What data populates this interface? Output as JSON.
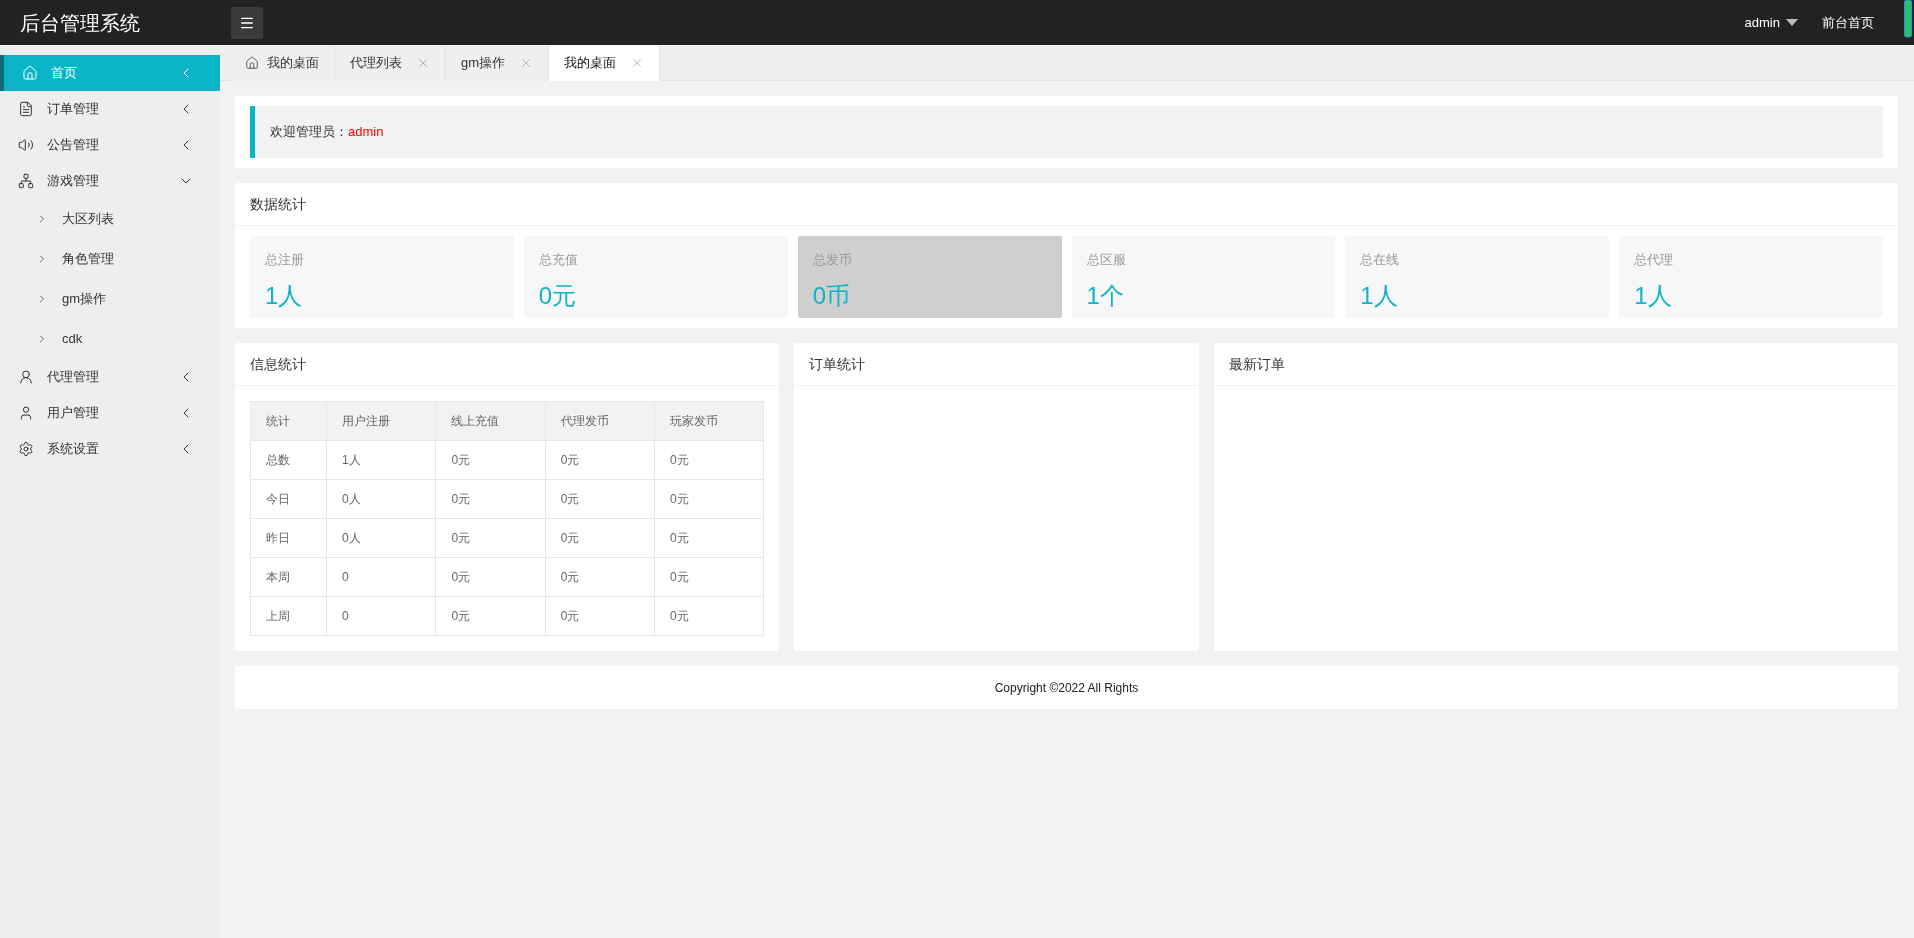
{
  "header": {
    "title": "后台管理系统",
    "user": "admin",
    "front_link": "前台首页"
  },
  "sidebar": {
    "items": [
      {
        "label": "首页",
        "kind": "home",
        "selected": true,
        "expanded": false
      },
      {
        "label": "订单管理",
        "kind": "order",
        "selected": false,
        "expanded": false
      },
      {
        "label": "公告管理",
        "kind": "speaker",
        "selected": false,
        "expanded": false
      },
      {
        "label": "游戏管理",
        "kind": "sitemap",
        "selected": false,
        "expanded": true,
        "children": [
          {
            "label": "大区列表"
          },
          {
            "label": "角色管理"
          },
          {
            "label": "gm操作"
          },
          {
            "label": "cdk"
          }
        ]
      },
      {
        "label": "代理管理",
        "kind": "agent",
        "selected": false,
        "expanded": false
      },
      {
        "label": "用户管理",
        "kind": "user",
        "selected": false,
        "expanded": false
      },
      {
        "label": "系统设置",
        "kind": "gear",
        "selected": false,
        "expanded": false
      }
    ]
  },
  "tabs": [
    {
      "label": "我的桌面",
      "kind": "home",
      "selected": false
    },
    {
      "label": "代理列表",
      "kind": "closable",
      "selected": false
    },
    {
      "label": "gm操作",
      "kind": "closable",
      "selected": false
    },
    {
      "label": "我的桌面",
      "kind": "closable",
      "selected": true
    }
  ],
  "welcome": {
    "label": "欢迎管理员：",
    "user": "admin"
  },
  "data_stats": {
    "title": "数据统计",
    "cards": [
      {
        "label": "总注册",
        "value": "1人",
        "highlighted": false
      },
      {
        "label": "总充值",
        "value": "0元",
        "highlighted": false
      },
      {
        "label": "总发币",
        "value": "0币",
        "highlighted": true
      },
      {
        "label": "总区服",
        "value": "1个",
        "highlighted": false
      },
      {
        "label": "总在线",
        "value": "1人",
        "highlighted": false
      },
      {
        "label": "总代理",
        "value": "1人",
        "highlighted": false
      }
    ]
  },
  "info_stats": {
    "title": "信息统计",
    "columns": [
      "统计",
      "用户注册",
      "线上充值",
      "代理发币",
      "玩家发币"
    ],
    "rows": [
      [
        "总数",
        "1人",
        "0元",
        "0元",
        "0元"
      ],
      [
        "今日",
        "0人",
        "0元",
        "0元",
        "0元"
      ],
      [
        "昨日",
        "0人",
        "0元",
        "0元",
        "0元"
      ],
      [
        "本周",
        "0",
        "0元",
        "0元",
        "0元"
      ],
      [
        "上周",
        "0",
        "0元",
        "0元",
        "0元"
      ]
    ]
  },
  "order_stats": {
    "title": "订单统计"
  },
  "latest_orders": {
    "title": "最新订单"
  },
  "footer": {
    "text": "Copyright ©2022 All Rights"
  }
}
